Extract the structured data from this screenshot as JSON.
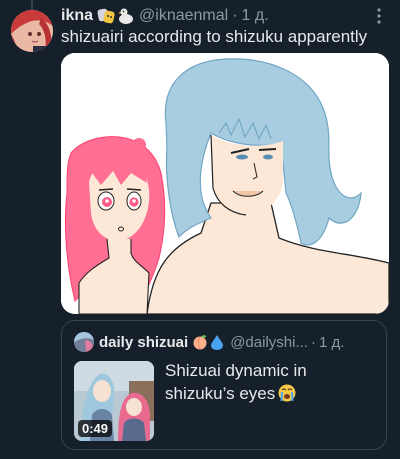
{
  "tweet": {
    "display_name": "ikna",
    "name_emojis": [
      "performing-arts-emoji",
      "duck-emoji"
    ],
    "handle": "@iknaenmal",
    "separator": "·",
    "timestamp": "1 д.",
    "text": "shizuairi according to shizuku apparently"
  },
  "media": {
    "icon": "drawing-image"
  },
  "quote": {
    "display_name": "daily shizuai",
    "name_emojis": [
      "peach-emoji",
      "droplet-emoji"
    ],
    "handle": "@dailyshi...",
    "separator": "·",
    "timestamp": "1 д.",
    "text": "Shizuai dynamic in shizuku’s eyes",
    "text_emoji": "crying-emoji",
    "video_duration": "0:49"
  },
  "colors": {
    "background": "#15202b",
    "primary_text": "#e7e9ea",
    "secondary_text": "#8b98a5",
    "border": "#38444d"
  }
}
